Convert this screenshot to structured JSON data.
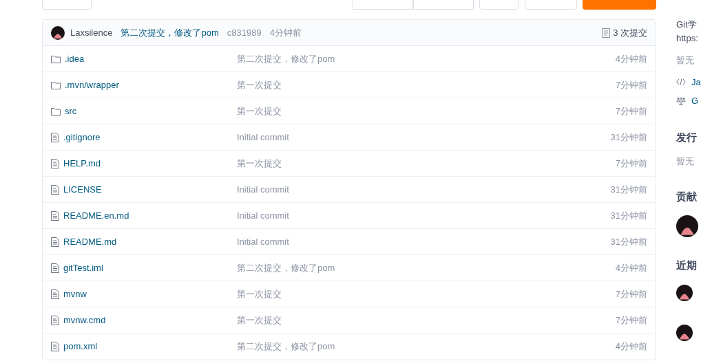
{
  "toolbar": {
    "buttons": [
      {
        "kind": "branch"
      },
      {
        "kind": "group"
      },
      {
        "kind": "group"
      },
      {
        "kind": "dropdown"
      },
      {
        "kind": "bold"
      },
      {
        "kind": "primary"
      }
    ]
  },
  "commit": {
    "author": "Laxsilence",
    "message": "第二次提交，修改了pom",
    "hash": "c831989",
    "time": "4分钟前",
    "count": "3 次提交"
  },
  "files": [
    {
      "kind": "folder",
      "name": ".idea",
      "message": "第二次提交，修改了pom",
      "time": "4分钟前"
    },
    {
      "kind": "folder",
      "name": ".mvn/wrapper",
      "message": "第一次提交",
      "time": "7分钟前"
    },
    {
      "kind": "folder",
      "name": "src",
      "message": "第一次提交",
      "time": "7分钟前"
    },
    {
      "kind": "file",
      "name": ".gitignore",
      "message": "Initial commit",
      "time": "31分钟前"
    },
    {
      "kind": "file",
      "name": "HELP.md",
      "message": "第一次提交",
      "time": "7分钟前"
    },
    {
      "kind": "file",
      "name": "LICENSE",
      "message": "Initial commit",
      "time": "31分钟前"
    },
    {
      "kind": "file",
      "name": "README.en.md",
      "message": "Initial commit",
      "time": "31分钟前"
    },
    {
      "kind": "file",
      "name": "README.md",
      "message": "Initial commit",
      "time": "31分钟前"
    },
    {
      "kind": "file",
      "name": "gitTest.iml",
      "message": "第二次提交，修改了pom",
      "time": "4分钟前"
    },
    {
      "kind": "file",
      "name": "mvnw",
      "message": "第一次提交",
      "time": "7分钟前"
    },
    {
      "kind": "file",
      "name": "mvnw.cmd",
      "message": "第一次提交",
      "time": "7分钟前"
    },
    {
      "kind": "file",
      "name": "pom.xml",
      "message": "第二次提交，修改了pom",
      "time": "4分钟前"
    }
  ],
  "sidebar": {
    "intro_lines": [
      "Git学",
      "https:"
    ],
    "no_tags": "暂无",
    "links": [
      {
        "kind": "code",
        "label": "Ja"
      },
      {
        "kind": "license",
        "label": "G"
      }
    ],
    "releases_title": "发行",
    "no_releases": "暂无",
    "contributors_title": "贡献",
    "activity_title": "近期"
  }
}
